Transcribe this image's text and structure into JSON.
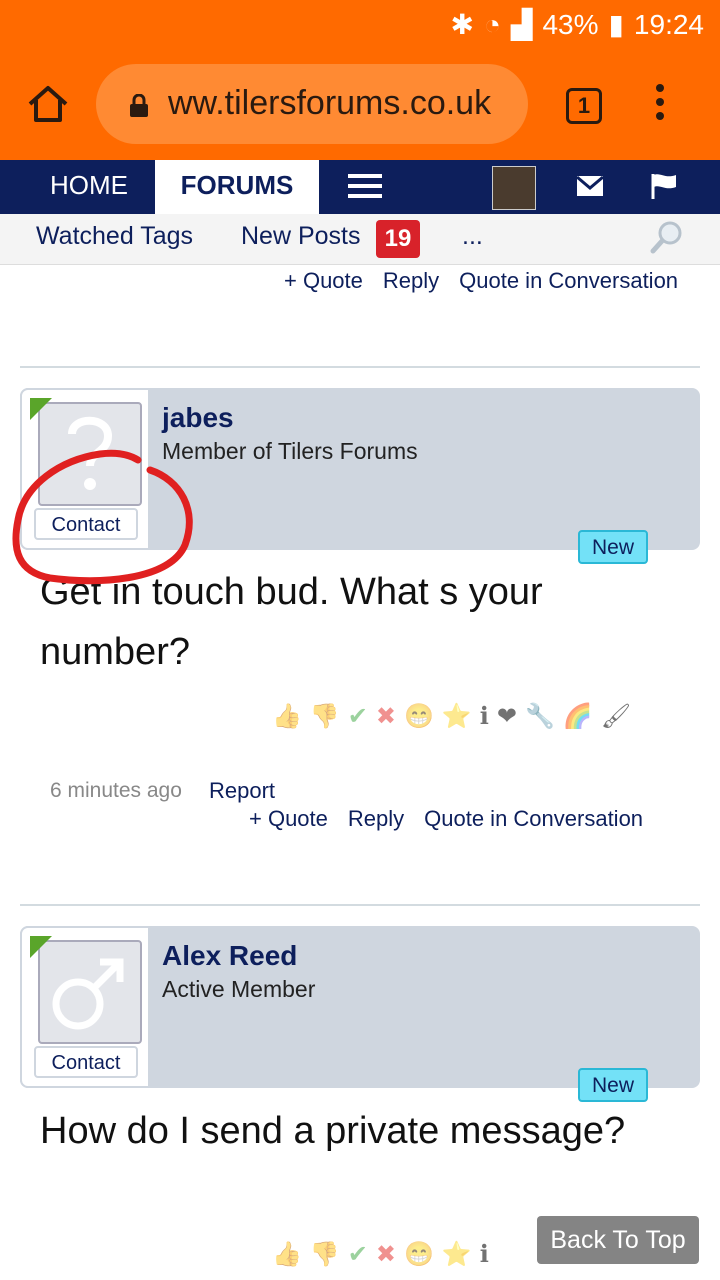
{
  "status_bar": {
    "battery": "43%",
    "time": "19:24"
  },
  "browser": {
    "url": "ww.tilersforums.co.uk",
    "tab_count": "1"
  },
  "site_nav": {
    "home": "HOME",
    "forums": "FORUMS"
  },
  "sub_nav": {
    "watched_tags": "Watched Tags",
    "new_posts": "New Posts",
    "new_posts_count": "19",
    "more": "..."
  },
  "post_actions": {
    "quote": "+ Quote",
    "reply": "Reply",
    "quote_conv": "Quote in Conversation",
    "report": "Report"
  },
  "posts": [
    {
      "username": "jabes",
      "title": "Member of Tilers Forums",
      "contact": "Contact",
      "badge": "New",
      "body": "Get in touch bud. What s your number?",
      "time": "6 minutes ago"
    },
    {
      "username": "Alex Reed",
      "title": "Active Member",
      "contact": "Contact",
      "badge": "New",
      "body": "How do I send a private message?"
    }
  ],
  "reactions": [
    "👍",
    "👎",
    "✔",
    "✖",
    "😁",
    "⭐",
    "ℹ",
    "❤",
    "🔧",
    "🌈",
    "🖌"
  ],
  "back_to_top": "Back To Top",
  "colors": {
    "chrome": "#ff6a00",
    "nav": "#0d1f5c",
    "post_head": "#cfd6df",
    "annotation": "#e02020"
  }
}
